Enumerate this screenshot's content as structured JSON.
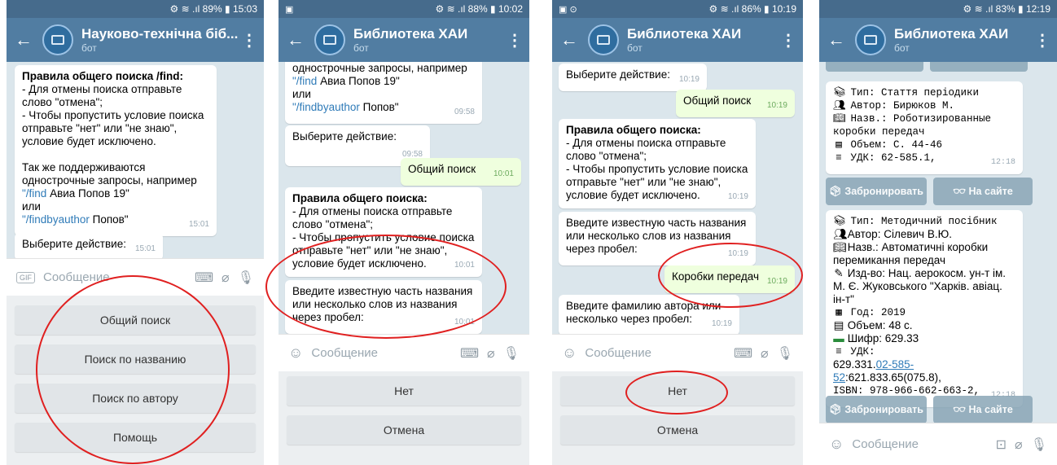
{
  "phones": [
    {
      "status": {
        "left": "",
        "right": "⚙ ≋ .ıl 89% ▮ 15:03"
      },
      "title": "Науково-технічна біб...",
      "subtitle": "бот",
      "messages": {
        "rules_head": "Правила общего поиска /find:",
        "rules_l1": " - Для отмены поиска отправьте слово \"отмена\";",
        "rules_l2": " - Чтобы пропустить условие поиска отправьте \"нет\" или \"не знаю\", условие будет исключено.",
        "also": "Так же поддерживаются однострочные запросы, например",
        "ex1_cmd": "\"/find",
        "ex1_rest": " Авиа Попов 19\"",
        "or": "или",
        "ex2_cmd": "\"/findbyauthor",
        "ex2_rest": " Попов\"",
        "t1": "15:01",
        "choose": "Выберите действие:",
        "t2": "15:01"
      },
      "input_placeholder": "Сообщение",
      "keyboard": [
        "Общий поиск",
        "Поиск по названию",
        "Поиск по автору",
        "Помощь"
      ]
    },
    {
      "status": {
        "left": "▣",
        "right": "⚙ ≋ .ıl 88% ▮ 10:02"
      },
      "title": "Библиотека ХАИ",
      "subtitle": "бот",
      "messages": {
        "top_l1": "однострочные запросы, например",
        "top_cmd": "\"/find",
        "top_rest": " Авиа Попов 19\"",
        "or": "или",
        "top_cmd2": "\"/findbyauthor",
        "top_rest2": " Попов\"",
        "t1": "09:58",
        "choose": "Выберите действие:",
        "t2": "09:58",
        "out": "Общий поиск",
        "t3": "10:01",
        "rules_head": "Правила общего поиска:",
        "rules_l1": " - Для отмены поиска отправьте слово \"отмена\";",
        "rules_l2": " - Чтобы пропустить условие поиска отправьте \"нет\" или \"не знаю\", условие будет исключено.",
        "t4": "10:01",
        "enter": "Введите известную часть названия или несколько слов из названия через пробел:",
        "t5": "10:01"
      },
      "input_placeholder": "Сообщение",
      "keyboard": [
        "Нет",
        "Отмена"
      ]
    },
    {
      "status": {
        "left": "▣ ⊙",
        "right": "⚙ ≋ .ıl 86% ▮ 10:19"
      },
      "title": "Библиотека ХАИ",
      "subtitle": "бот",
      "messages": {
        "choose": "Выберите действие:",
        "t1": "10:19",
        "out1": "Общий поиск",
        "t2": "10:19",
        "rules_head": "Правила общего поиска:",
        "rules_l1": " - Для отмены поиска отправьте слово \"отмена\";",
        "rules_l2": " - Чтобы пропустить условие поиска отправьте \"нет\" или \"не знаю\", условие будет исключено.",
        "t3": "10:19",
        "enter": "Введите известную часть названия или несколько слов из названия через пробел:",
        "t4": "10:19",
        "out2": "Коробки передач",
        "t5": "10:19",
        "author": "Введите фамилию автора или несколько через пробел:",
        "t6": "10:19"
      },
      "input_placeholder": "Сообщение",
      "keyboard": [
        "Нет",
        "Отмена"
      ]
    },
    {
      "status": {
        "left": "",
        "right": "⚙ ≋ .ıl 83% ▮ 12:19"
      },
      "title": "Библиотека ХАИ",
      "subtitle": "бот",
      "card1": {
        "type": "Тип: Стаття періодики",
        "author": "Автор: Бирюков М.",
        "name": "Назв.: Роботизированные коробки передач",
        "volume": "Объем: С. 44-46",
        "udk": "УДК: 62-585.1,",
        "time": "12:18"
      },
      "card2": {
        "type": "Тип: Методичний посібник",
        "author": "Автор: Сілевич В.Ю.",
        "name": "Назв.: Автоматичні коробки перемикання передач",
        "publisher": "Изд-во: Нац. аерокосм. ун-т ім. М. Є. Жуковського \"Харків. авіац. ін-т\"",
        "year": "Год: 2019",
        "volume": "Объем: 48 с.",
        "cipher": "Шифр: 629.33",
        "udk_label": "УДК:",
        "udk_pre": "629.331.",
        "udk_link": "02-585-52",
        "udk_post": ":621.833.65(075.8),",
        "isbn": "ISBN: 978-966-662-663-2,",
        "time": "12:18"
      },
      "buttons": {
        "reserve": "Забронировать",
        "site": "На сайте"
      },
      "input_placeholder": "Сообщение"
    }
  ],
  "colors": {
    "header": "#517da2",
    "statusbar": "#466b8c",
    "highlight": "#e02020",
    "outgoing": "#efffde"
  }
}
